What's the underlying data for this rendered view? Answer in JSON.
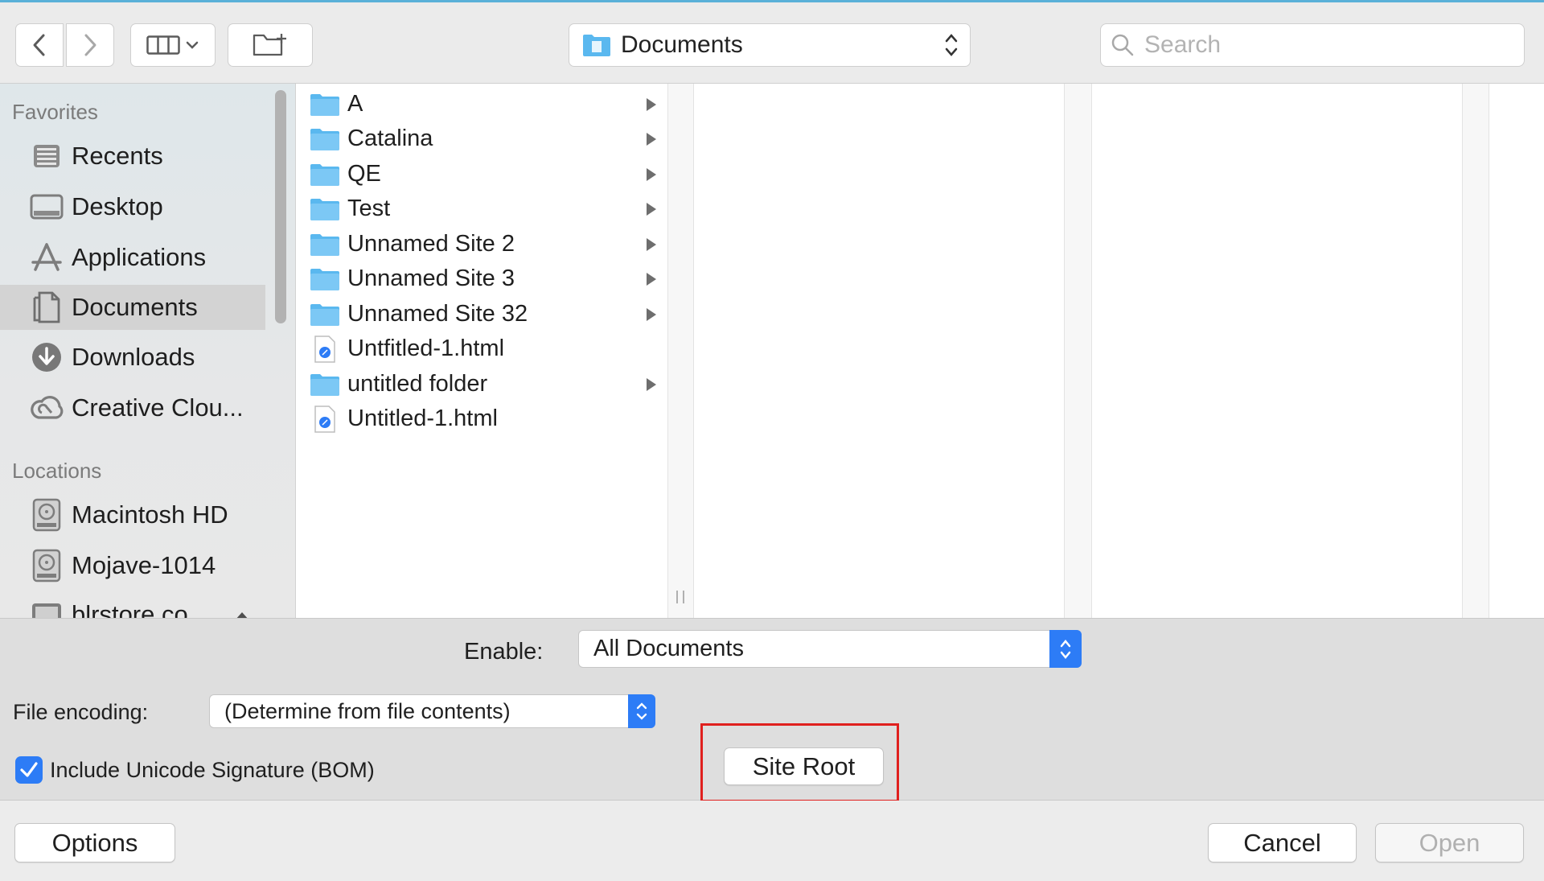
{
  "toolbar": {
    "path_popup_label": "Documents",
    "search_placeholder": "Search"
  },
  "sidebar": {
    "favorites_header": "Favorites",
    "favorites": [
      {
        "label": "Recents",
        "icon": "recents-icon"
      },
      {
        "label": "Desktop",
        "icon": "desktop-icon"
      },
      {
        "label": "Applications",
        "icon": "applications-icon"
      },
      {
        "label": "Documents",
        "icon": "documents-icon",
        "selected": true
      },
      {
        "label": "Downloads",
        "icon": "downloads-icon"
      },
      {
        "label": "Creative Clou...",
        "icon": "creative-cloud-icon"
      }
    ],
    "locations_header": "Locations",
    "locations": [
      {
        "label": "Macintosh HD",
        "icon": "hard-drive-icon"
      },
      {
        "label": "Mojave-1014",
        "icon": "hard-drive-icon"
      },
      {
        "label": "blrstore.co...",
        "icon": "network-drive-icon",
        "eject": true
      }
    ]
  },
  "files": [
    {
      "name": "A",
      "type": "folder"
    },
    {
      "name": "Catalina",
      "type": "folder"
    },
    {
      "name": "QE",
      "type": "folder"
    },
    {
      "name": "Test",
      "type": "folder"
    },
    {
      "name": "Unnamed Site 2",
      "type": "folder"
    },
    {
      "name": "Unnamed Site 3",
      "type": "folder"
    },
    {
      "name": "Unnamed Site 32",
      "type": "folder"
    },
    {
      "name": "Untfitled-1.html",
      "type": "html"
    },
    {
      "name": "untitled folder",
      "type": "folder"
    },
    {
      "name": "Untitled-1.html",
      "type": "html"
    }
  ],
  "accessory": {
    "enable_label": "Enable:",
    "enable_value": "All Documents",
    "encoding_label": "File encoding:",
    "encoding_value": "(Determine from file contents)",
    "bom_label": "Include Unicode Signature (BOM)",
    "bom_checked": true,
    "site_root_label": "Site Root"
  },
  "footer": {
    "options_label": "Options",
    "cancel_label": "Cancel",
    "open_label": "Open"
  },
  "colors": {
    "accent": "#2d7cf6",
    "folder": "#5ab8ef",
    "highlight": "#e0201e"
  }
}
